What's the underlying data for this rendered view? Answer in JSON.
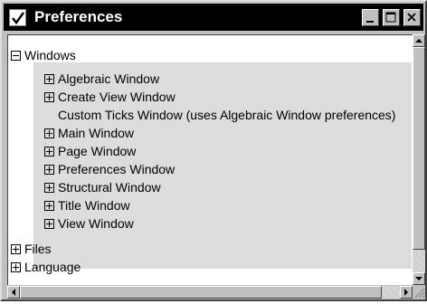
{
  "window": {
    "title": "Preferences",
    "icon": "checkmark-icon",
    "controls": [
      "minimize-icon",
      "maximize-icon",
      "close-icon"
    ]
  },
  "tree": {
    "windows": {
      "label": "Windows",
      "expanded": true,
      "children": [
        {
          "label": "Algebraic Window",
          "toggle": "plus"
        },
        {
          "label": "Create View Window",
          "toggle": "plus"
        },
        {
          "label": "Custom Ticks Window (uses Algebraic Window preferences)",
          "toggle": "none"
        },
        {
          "label": "Main Window",
          "toggle": "plus"
        },
        {
          "label": "Page Window",
          "toggle": "plus"
        },
        {
          "label": "Preferences Window",
          "toggle": "plus"
        },
        {
          "label": "Structural Window",
          "toggle": "plus"
        },
        {
          "label": "Title Window",
          "toggle": "plus"
        },
        {
          "label": "View Window",
          "toggle": "plus"
        }
      ]
    },
    "files": {
      "label": "Files",
      "expanded": false
    },
    "language": {
      "label": "Language",
      "expanded": false
    }
  },
  "colors": {
    "titlebar": "#000000",
    "chrome": "#c0c0c0",
    "selection_band": "#dcdcdc",
    "content_bg": "#ffffff"
  }
}
